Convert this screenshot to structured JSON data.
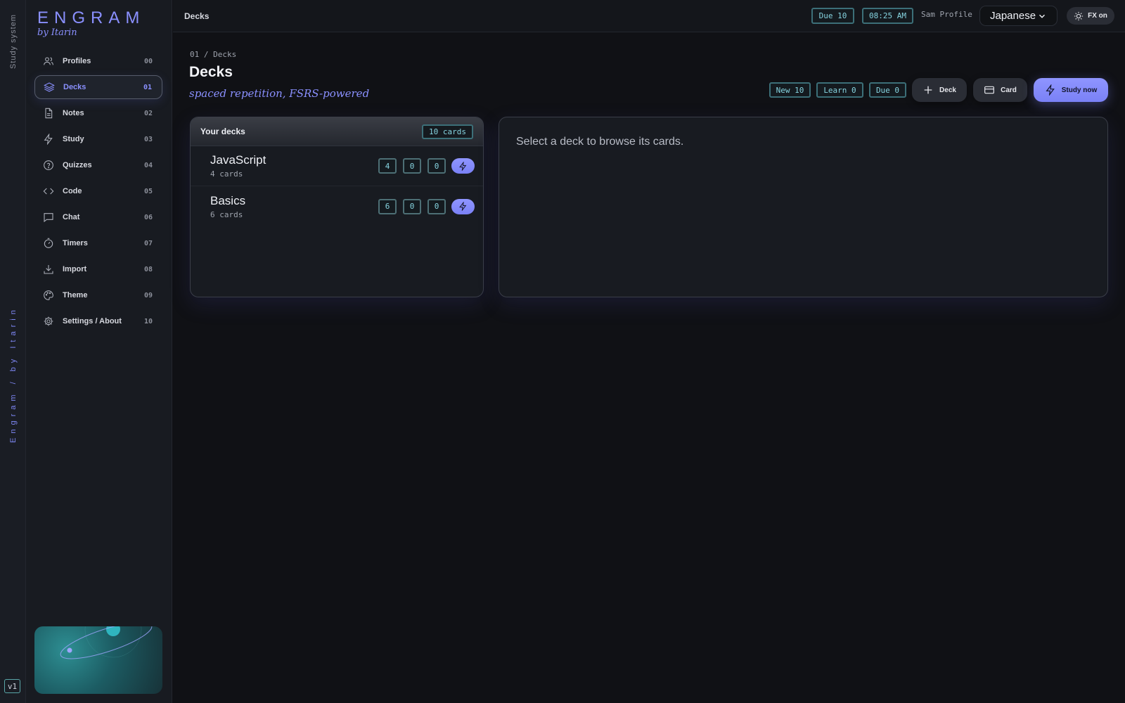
{
  "rail": {
    "top_label": "Study system",
    "mid_label": "Engram / by Itarin",
    "version": "v1"
  },
  "brand": {
    "title": "ENGRAM",
    "subtitle": "by Itarin"
  },
  "nav": [
    {
      "label": "Profiles",
      "num": "00",
      "icon": "users-icon"
    },
    {
      "label": "Decks",
      "num": "01",
      "icon": "layers-icon",
      "active": true
    },
    {
      "label": "Notes",
      "num": "02",
      "icon": "note-icon"
    },
    {
      "label": "Study",
      "num": "03",
      "icon": "bolt-icon"
    },
    {
      "label": "Quizzes",
      "num": "04",
      "icon": "question-icon"
    },
    {
      "label": "Code",
      "num": "05",
      "icon": "code-icon"
    },
    {
      "label": "Chat",
      "num": "06",
      "icon": "chat-icon"
    },
    {
      "label": "Timers",
      "num": "07",
      "icon": "timer-icon"
    },
    {
      "label": "Import",
      "num": "08",
      "icon": "download-icon"
    },
    {
      "label": "Theme",
      "num": "09",
      "icon": "palette-icon"
    },
    {
      "label": "Settings / About",
      "num": "10",
      "icon": "gear-icon"
    }
  ],
  "topbar": {
    "title": "Decks",
    "due": "Due 10",
    "time": "08:25 AM",
    "user": "Sam Profile",
    "language": "Japanese",
    "fx": "FX on"
  },
  "main": {
    "breadcrumb": "01 / Decks",
    "title": "Decks",
    "subtitle": "spaced repetition, FSRS-powered",
    "stats": {
      "new": "New 10",
      "learn": "Learn 0",
      "due": "Due 0"
    },
    "actions": {
      "deck": "Deck",
      "card": "Card",
      "study": "Study now"
    }
  },
  "decks": {
    "header": "Your decks",
    "count": "10 cards",
    "rows": [
      {
        "name": "JavaScript",
        "cards": "4 cards",
        "new": "4",
        "learn": "0",
        "due": "0"
      },
      {
        "name": "Basics",
        "cards": "6 cards",
        "new": "6",
        "learn": "0",
        "due": "0"
      }
    ]
  },
  "browse": {
    "empty_text": "Select a deck to browse its cards."
  },
  "colors": {
    "accent": "#8a90ff",
    "teal": "#86d4e0",
    "background": "#101115"
  }
}
